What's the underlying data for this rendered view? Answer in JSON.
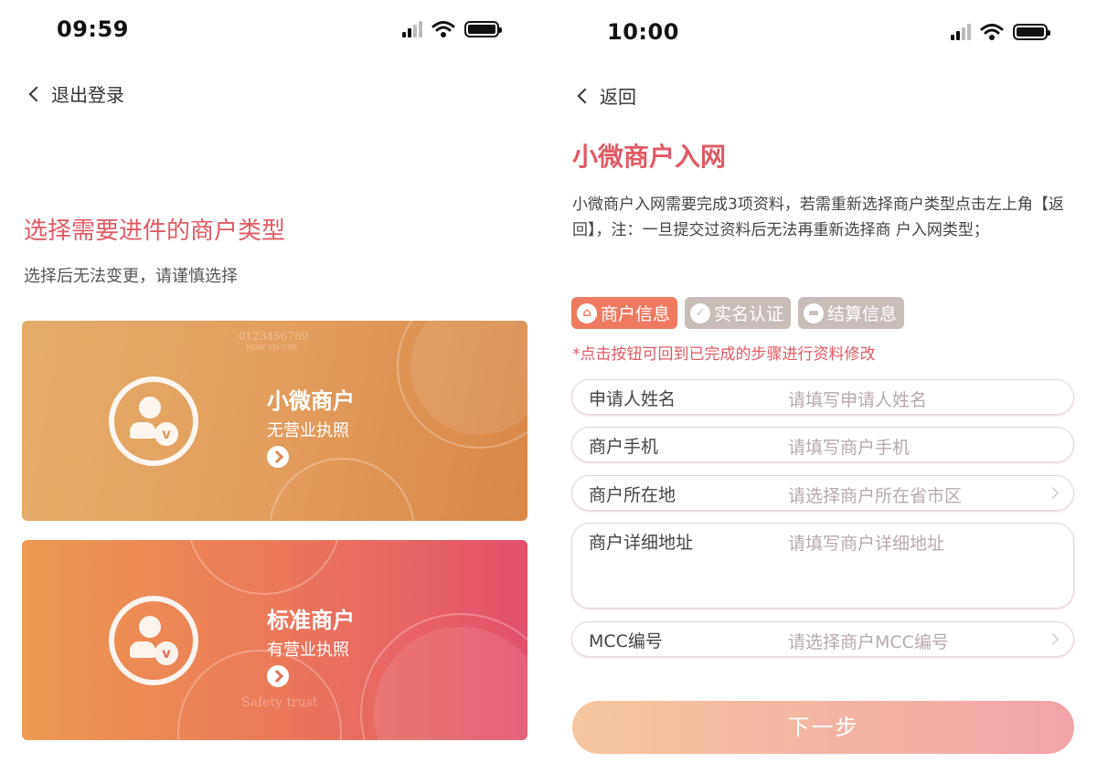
{
  "left": {
    "status": {
      "time": "09:59"
    },
    "back_label": "退出登录",
    "title": "选择需要进件的商户类型",
    "subtitle": "选择后无法变更，请谨慎选择",
    "cards": [
      {
        "title": "小微商户",
        "subtitle": "无营业执照",
        "badge": "v",
        "deco_text": "0123456789",
        "deco_text2": "HOW TO USE"
      },
      {
        "title": "标准商户",
        "subtitle": "有营业执照",
        "badge": "v",
        "deco_text": "Safety trust"
      }
    ]
  },
  "right": {
    "status": {
      "time": "10:00"
    },
    "back_label": "返回",
    "title": "小微商户入网",
    "description": "小微商户入网需要完成3项资料，若需重新选择商户类型点击左上角【返回】，注：一旦提交过资料后无法再重新选择商 户入网类型；",
    "steps": [
      {
        "label": "商户信息",
        "icon": "home-icon",
        "active": true
      },
      {
        "label": "实名认证",
        "icon": "check-badge-icon",
        "active": false
      },
      {
        "label": "结算信息",
        "icon": "card-icon",
        "active": false
      }
    ],
    "hint": "*点击按钮可回到已完成的步骤进行资料修改",
    "fields": [
      {
        "label": "申请人姓名",
        "placeholder": "请填写申请人姓名",
        "type": "text"
      },
      {
        "label": "商户手机",
        "placeholder": "请填写商户手机",
        "type": "text"
      },
      {
        "label": "商户所在地",
        "placeholder": "请选择商户所在省市区",
        "type": "select"
      },
      {
        "label": "商户详细地址",
        "placeholder": "请填写商户详细地址",
        "type": "textarea"
      },
      {
        "label": "MCC编号",
        "placeholder": "请选择商户MCC编号",
        "type": "select"
      }
    ],
    "next_label": "下一步"
  },
  "colors": {
    "accent": "#e05a66",
    "step_active": "#ee7b5f",
    "step_inactive": "#c9bdba"
  }
}
